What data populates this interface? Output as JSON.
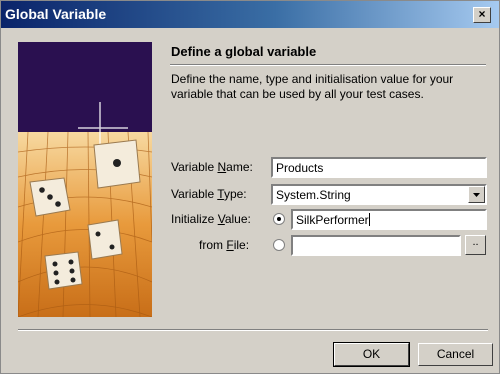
{
  "window": {
    "title": "Global Variable",
    "close_label": "×"
  },
  "header": {
    "title": "Define a global variable",
    "description": "Define the name, type and initialisation value for your variable that can be used by all your test cases."
  },
  "form": {
    "name_label": {
      "pre": "Variable ",
      "underlined": "N",
      "post": "ame:"
    },
    "name_value": "Products",
    "type_label": {
      "pre": "Variable ",
      "underlined": "T",
      "post": "ype:"
    },
    "type_value": "System.String",
    "init_label": {
      "pre": "Initialize ",
      "underlined": "V",
      "post": "alue:"
    },
    "init_value": "SilkPerformer",
    "file_label": {
      "pre": "from ",
      "underlined": "F",
      "post": "ile:"
    },
    "file_value": "",
    "browse_label": "..",
    "selected_source": "initialize_value"
  },
  "buttons": {
    "ok": "OK",
    "cancel": "Cancel"
  },
  "colors": {
    "title_bar_start": "#0a246a",
    "title_bar_end": "#a6caf0",
    "dialog_bg": "#d4d0c8",
    "image_sky": "#2a1050"
  },
  "icons": {
    "close": "close-icon",
    "combo": "chevron-down-icon",
    "image": "dice-illustration"
  }
}
